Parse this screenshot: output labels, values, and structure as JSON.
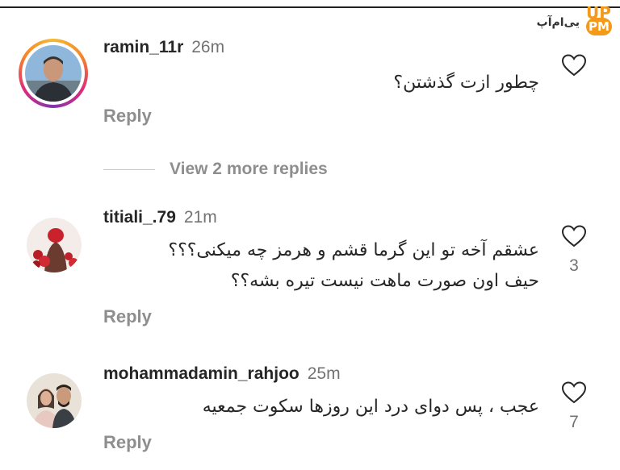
{
  "watermark": {
    "text": "یی‌ام‌آپ",
    "mark_top": "UP",
    "mark_badge": "PM",
    "color": "#f39a1a"
  },
  "comments": [
    {
      "username": "ramin_11r",
      "time": "26m",
      "lines": [
        "چطور ازت گذشتن؟"
      ],
      "reply_label": "Reply",
      "likes": "",
      "view_replies": "View 2 more replies",
      "avatar_icon": "profile-photo-man"
    },
    {
      "username": "titiali_.79",
      "time": "21m",
      "lines": [
        "عشقم آخه تو این گرما قشم و هرمز چه میکنی؟؟؟",
        "حیف اون صورت ماهت نیست تیره بشه؟؟"
      ],
      "reply_label": "Reply",
      "likes": "3",
      "avatar_icon": "profile-photo-roses"
    },
    {
      "username": "mohammadamin_rahjoo",
      "time": "25m",
      "lines": [
        "عجب ، پس دوای درد این روزها سکوت جمعیه"
      ],
      "reply_label": "Reply",
      "likes": "7",
      "avatar_icon": "profile-photo-couple"
    }
  ]
}
